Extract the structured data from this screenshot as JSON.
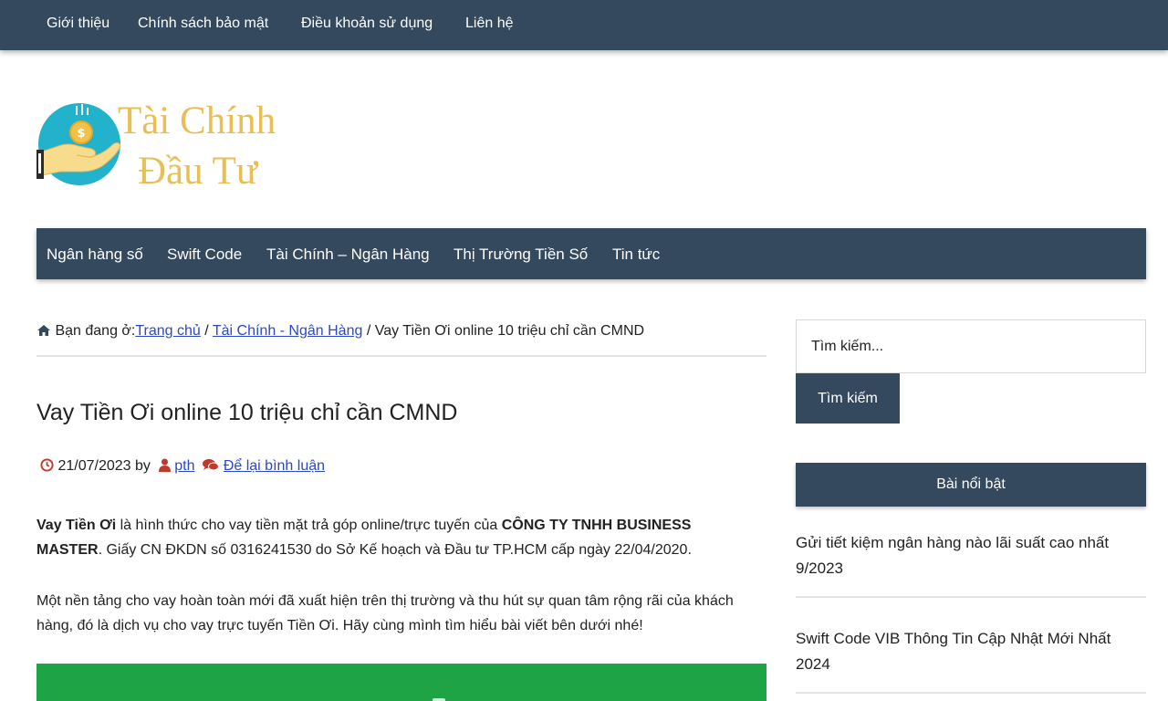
{
  "top_nav": {
    "items": [
      {
        "label": "Giới thiệu"
      },
      {
        "label": "Chính sách bảo mật"
      },
      {
        "label": "Điều khoản sử dụng"
      },
      {
        "label": "Liên hệ"
      }
    ]
  },
  "logo": {
    "line1": "Tài Chính",
    "line2": "Đầu Tư",
    "brand_color": "#e8bf55",
    "icon": "hand-holding-coin-icon"
  },
  "main_nav": {
    "items": [
      {
        "label": "Ngân hàng số"
      },
      {
        "label": "Swift Code"
      },
      {
        "label": "Tài Chính – Ngân Hàng"
      },
      {
        "label": "Thị Trường Tiền Số"
      },
      {
        "label": "Tin tức"
      }
    ]
  },
  "breadcrumb": {
    "prefix": "Bạn đang ở:",
    "home": "Trang chủ",
    "sep1": " / ",
    "category": "Tài Chính - Ngân Hàng",
    "sep2": " / ",
    "current": "Vay Tiền Ơi online 10 triệu chỉ cần CMND",
    "icon": "home-icon"
  },
  "post": {
    "title": "Vay Tiền Ơi online 10 triệu chỉ cần CMND",
    "date": "21/07/2023",
    "by": "by",
    "author": "pth",
    "comment_link": "Để lại bình luận",
    "p1": {
      "bold1": "Vay Tiền Ơi",
      "text1": " là hình thức cho vay tiền mặt trả góp online/trực tuyến của ",
      "bold2": "CÔNG TY TNHH BUSINESS MASTER",
      "text2": ". Giấy CN ĐKDN số 0316241530 do Sở Kế hoạch và Đầu tư TP.HCM cấp ngày 22/04/2020."
    },
    "p2": "Một nền tảng cho vay hoàn toàn mới đã xuất hiện trên thị trường và thu hút sự quan tâm rộng rãi của khách hàng, đó là dịch vụ cho vay trực tuyến Tiền Ơi. Hãy cùng mình tìm hiểu bài viết bên dưới nhé!"
  },
  "sidebar": {
    "search_placeholder": "Tìm kiếm...",
    "search_button": "Tìm kiếm",
    "widget_title": "Bài nổi bật",
    "posts": [
      {
        "title": "Gửi tiết kiệm ngân hàng nào lãi suất cao nhất 9/2023"
      },
      {
        "title": "Swift Code VIB Thông Tin Cập Nhật Mới Nhất 2024"
      }
    ]
  },
  "colors": {
    "nav_bg": "#34495e",
    "link": "#2c48c7",
    "cta_green": "#1ea345",
    "meta_icon_red": "#c0392b"
  }
}
